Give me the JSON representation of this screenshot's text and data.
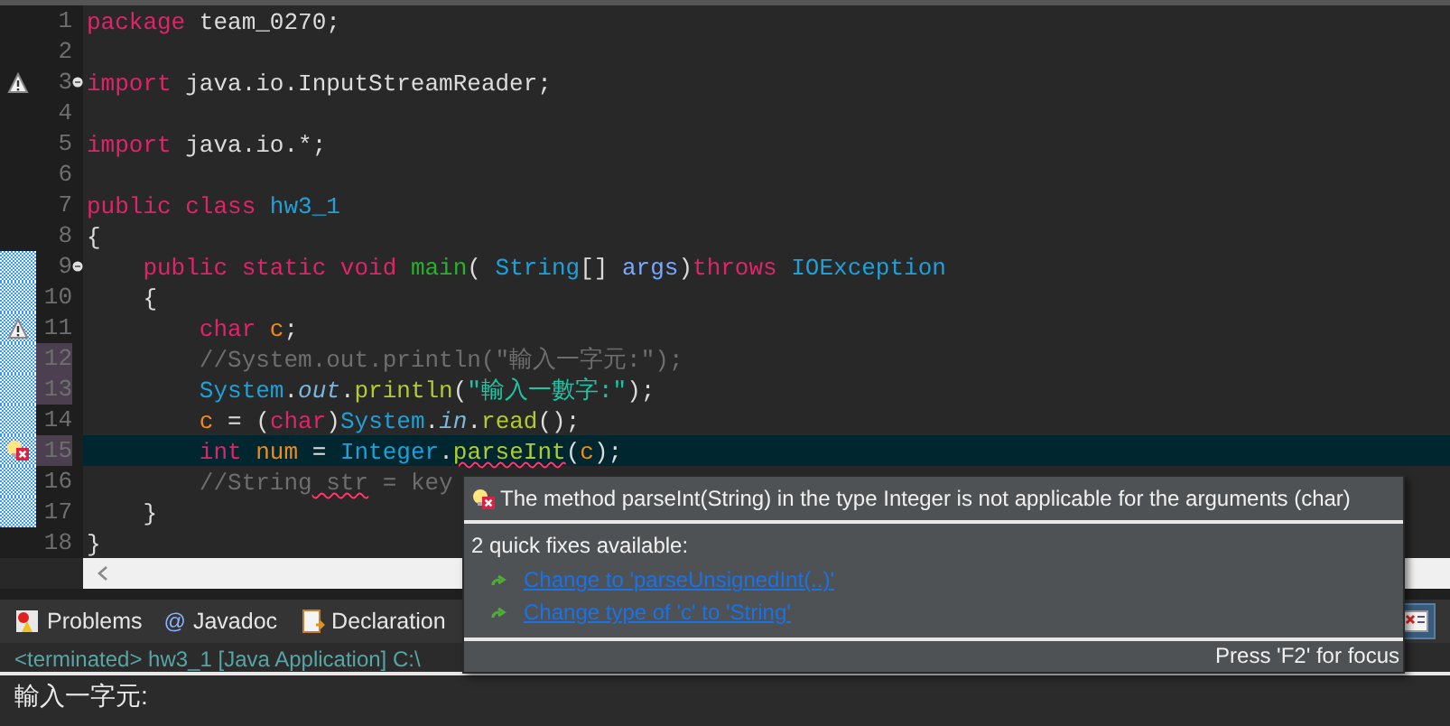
{
  "editor": {
    "lines": [
      {
        "number": "1",
        "in_range": false,
        "highlighted": false,
        "current": false,
        "tokens": [
          {
            "kind": "keyword",
            "text": "package"
          },
          {
            "kind": "plain",
            "text": " team_0270;"
          }
        ]
      },
      {
        "number": "2",
        "in_range": false,
        "highlighted": false,
        "current": false
      },
      {
        "number": "3",
        "in_range": false,
        "highlighted": false,
        "current": false,
        "annotation": {
          "kind": "warning"
        },
        "folding": {
          "kind": "collapse"
        },
        "tokens": [
          {
            "kind": "keyword",
            "text": "import"
          },
          {
            "kind": "plain",
            "text": " java.io.InputStreamReader;"
          }
        ]
      },
      {
        "number": "4",
        "in_range": false,
        "highlighted": false,
        "current": false
      },
      {
        "number": "5",
        "in_range": false,
        "highlighted": false,
        "current": false,
        "tokens": [
          {
            "kind": "keyword",
            "text": "import"
          },
          {
            "kind": "plain",
            "text": " java.io.*;"
          }
        ]
      },
      {
        "number": "6",
        "in_range": false,
        "highlighted": false,
        "current": false
      },
      {
        "number": "7",
        "in_range": false,
        "highlighted": false,
        "current": false,
        "tokens": [
          {
            "kind": "keyword",
            "text": "public"
          },
          {
            "kind": "keyword",
            "text": " class"
          },
          {
            "kind": "type",
            "text": " hw3_1"
          }
        ]
      },
      {
        "number": "8",
        "in_range": false,
        "highlighted": false,
        "current": false,
        "tokens": [
          {
            "kind": "plain",
            "text": "{"
          }
        ]
      },
      {
        "number": "9",
        "in_range": true,
        "highlighted": false,
        "current": false,
        "folding": {
          "kind": "collapse"
        },
        "tokens": [
          {
            "kind": "keyword",
            "text": "    public"
          },
          {
            "kind": "keyword",
            "text": " static"
          },
          {
            "kind": "keyword",
            "text": " void"
          },
          {
            "kind": "method",
            "text": " main"
          },
          {
            "kind": "plain",
            "text": "("
          },
          {
            "kind": "type",
            "text": " String"
          },
          {
            "kind": "plain",
            "text": "[]"
          },
          {
            "kind": "param",
            "text": " args"
          },
          {
            "kind": "plain",
            "text": ")"
          },
          {
            "kind": "keyword",
            "text": "throws"
          },
          {
            "kind": "type",
            "text": " IOException"
          }
        ]
      },
      {
        "number": "10",
        "in_range": true,
        "highlighted": false,
        "current": false,
        "tokens": [
          {
            "kind": "plain",
            "text": "    {"
          }
        ]
      },
      {
        "number": "11",
        "in_range": true,
        "highlighted": false,
        "current": false,
        "annotation": {
          "kind": "warning"
        },
        "tokens": [
          {
            "kind": "keyword",
            "text": "        char"
          },
          {
            "kind": "variable",
            "text": " c"
          },
          {
            "kind": "plain",
            "text": ";"
          }
        ]
      },
      {
        "number": "12",
        "in_range": true,
        "highlighted": true,
        "current": false,
        "tokens": [
          {
            "kind": "comment",
            "text": "        //System.out.println(\"輸入一字元:\");"
          }
        ]
      },
      {
        "number": "13",
        "in_range": true,
        "highlighted": true,
        "current": false,
        "tokens": [
          {
            "kind": "type",
            "text": "        System"
          },
          {
            "kind": "plain",
            "text": "."
          },
          {
            "kind": "field",
            "text": "out"
          },
          {
            "kind": "plain",
            "text": "."
          },
          {
            "kind": "call",
            "text": "println"
          },
          {
            "kind": "plain",
            "text": "("
          },
          {
            "kind": "string",
            "text": "\"輸入一數字:\""
          },
          {
            "kind": "plain",
            "text": ");"
          }
        ]
      },
      {
        "number": "14",
        "in_range": true,
        "highlighted": false,
        "current": false,
        "tokens": [
          {
            "kind": "variable",
            "text": "        c"
          },
          {
            "kind": "plain",
            "text": " = ("
          },
          {
            "kind": "keyword",
            "text": "char"
          },
          {
            "kind": "plain",
            "text": ")"
          },
          {
            "kind": "type",
            "text": "System"
          },
          {
            "kind": "plain",
            "text": "."
          },
          {
            "kind": "field",
            "text": "in"
          },
          {
            "kind": "plain",
            "text": "."
          },
          {
            "kind": "call",
            "text": "read"
          },
          {
            "kind": "plain",
            "text": "();"
          }
        ]
      },
      {
        "number": "15",
        "in_range": true,
        "highlighted": true,
        "current": true,
        "annotation": {
          "kind": "error"
        },
        "tokens": [
          {
            "kind": "keyword",
            "text": "        int"
          },
          {
            "kind": "variable",
            "text": " num"
          },
          {
            "kind": "plain",
            "text": " ="
          },
          {
            "kind": "type",
            "text": " Integer"
          },
          {
            "kind": "plain",
            "text": "."
          },
          {
            "kind": "call",
            "text": "parseInt",
            "squiggle": true
          },
          {
            "kind": "plain",
            "text": "("
          },
          {
            "kind": "variable",
            "text": "c"
          },
          {
            "kind": "plain",
            "text": ");"
          }
        ]
      },
      {
        "number": "16",
        "in_range": true,
        "highlighted": false,
        "current": false,
        "tokens": [
          {
            "kind": "comment",
            "text": "        //String"
          },
          {
            "kind": "comment",
            "text": " str",
            "squiggle": true
          },
          {
            "kind": "comment",
            "text": " = key"
          }
        ]
      },
      {
        "number": "17",
        "in_range": true,
        "highlighted": false,
        "current": false,
        "tokens": [
          {
            "kind": "plain",
            "text": "    }"
          }
        ]
      },
      {
        "number": "18",
        "in_range": false,
        "highlighted": false,
        "current": false,
        "tokens": [
          {
            "kind": "plain",
            "text": "}"
          }
        ]
      }
    ]
  },
  "hover": {
    "message": "The method parseInt(String) in the type Integer is not applicable for the arguments (char)",
    "fixes_heading": "2 quick fixes available:",
    "fixes": [
      "Change to 'parseUnsignedInt(..)'",
      "Change type of 'c' to 'String'"
    ],
    "footer": "Press 'F2' for focus"
  },
  "bottom_tabs": [
    {
      "kind": "problems",
      "label": "Problems"
    },
    {
      "kind": "at",
      "icon_text": "@",
      "label": "Javadoc"
    },
    {
      "kind": "declaration",
      "label": "Declaration"
    }
  ],
  "console": {
    "header": "<terminated> hw3_1 [Java Application] C:\\",
    "output": "輸入一字元:"
  }
}
